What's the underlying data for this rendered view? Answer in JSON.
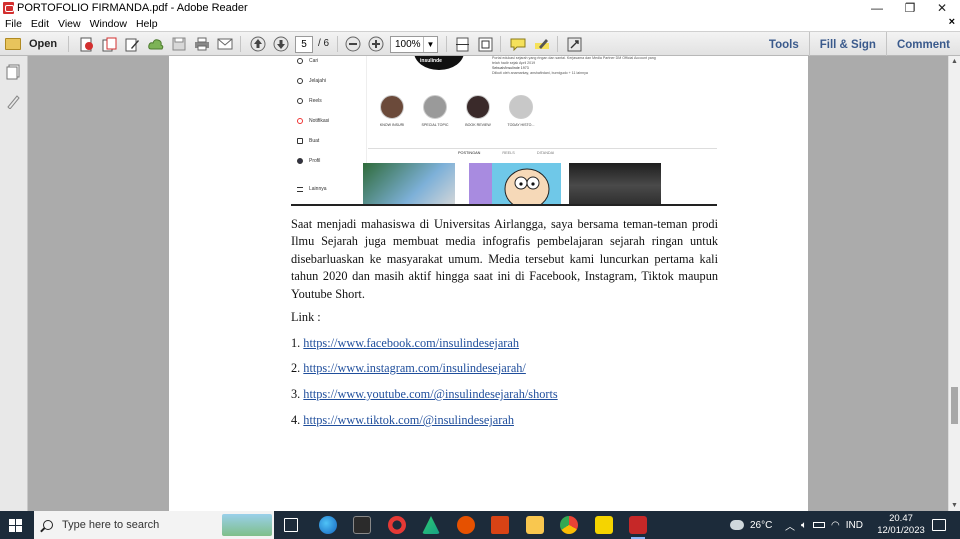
{
  "window": {
    "title": "PORTOFOLIO FIRMANDA.pdf - Adobe Reader",
    "controls": {
      "minimize": "—",
      "restore": "❐",
      "close": "✕"
    },
    "doc_close": "×"
  },
  "menu": [
    "File",
    "Edit",
    "View",
    "Window",
    "Help"
  ],
  "toolbar": {
    "open_label": "Open",
    "page_current": "5",
    "page_total": "/ 6",
    "zoom": "100%",
    "tools_label": "Tools",
    "fill_sign_label": "Fill & Sign",
    "comment_label": "Comment"
  },
  "instagram": {
    "nav": [
      "Cari",
      "Jelajahi",
      "Reels",
      "Notifikasi",
      "Buat",
      "Profil",
      "Lainnya"
    ],
    "avatar_text": "insulinde",
    "bio": [
      "Portal edukasi sejarah yang ringan dan santai. Kerjasama dan Media Partner DM Official Account yang",
      "telah hadir sejak April 2019",
      "Sebuah/Insulinde 1973",
      "Diikuti oleh anamarkay, anshafirdani, burnigudo + 11 lainnya"
    ],
    "highlights": [
      "KNOW INSURI",
      "SPECIAL TOPIC",
      "BOOK REVIEW",
      "TODAY HISTO..."
    ],
    "tabs": [
      "POSTINGAN",
      "REELS",
      "DITANDAI"
    ]
  },
  "document": {
    "paragraph": "Saat menjadi mahasiswa di Universitas Airlangga, saya bersama teman-teman prodi Ilmu Sejarah juga membuat media infografis pembelajaran sejarah ringan untuk disebarluaskan ke masyarakat umum. Media tersebut kami luncurkan pertama kali tahun 2020 dan masih aktif hingga saat ini di Facebook, Instagram, Tiktok maupun Youtube Short.",
    "link_heading": "Link :",
    "links": [
      {
        "num": "1. ",
        "url": "https://www.facebook.com/insulindesejarah"
      },
      {
        "num": "2. ",
        "url": "https://www.instagram.com/insulindesejarah/"
      },
      {
        "num": "3. ",
        "url": "https://www.youtube.com/@insulindesejarah/shorts"
      },
      {
        "num": "4. ",
        "url": "https://www.tiktok.com/@insulindesejarah"
      }
    ]
  },
  "taskbar": {
    "search_placeholder": "Type here to search",
    "temperature": "26°C",
    "language": "IND",
    "time": "20.47",
    "date": "12/01/2023"
  },
  "colors": {
    "accent_link": "#1f4e9c",
    "taskbar": "#1c2b3a",
    "adobe_red": "#d32f2f"
  }
}
